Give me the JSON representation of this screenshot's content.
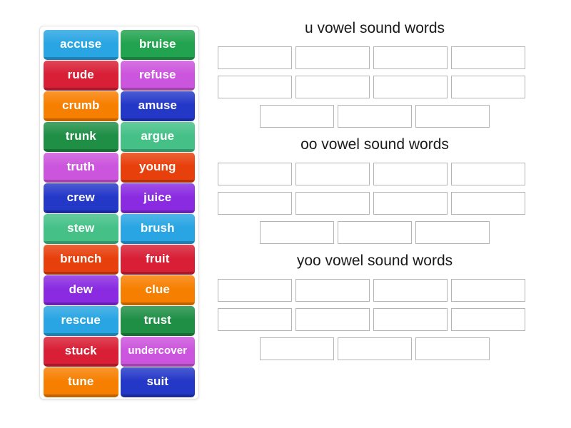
{
  "activity": {
    "type": "group-sort",
    "word_bank": {
      "tiles": [
        {
          "label": "accuse",
          "color": "#29a5e3"
        },
        {
          "label": "bruise",
          "color": "#22a34f"
        },
        {
          "label": "rude",
          "color": "#d81f35"
        },
        {
          "label": "refuse",
          "color": "#cc55dd"
        },
        {
          "label": "crumb",
          "color": "#f77f00"
        },
        {
          "label": "amuse",
          "color": "#2438c8"
        },
        {
          "label": "trunk",
          "color": "#1f8f46"
        },
        {
          "label": "argue",
          "color": "#45c188"
        },
        {
          "label": "truth",
          "color": "#cc55dd"
        },
        {
          "label": "young",
          "color": "#e8400c"
        },
        {
          "label": "crew",
          "color": "#2438c8"
        },
        {
          "label": "juice",
          "color": "#8a2be2"
        },
        {
          "label": "stew",
          "color": "#45c188"
        },
        {
          "label": "brush",
          "color": "#29a5e3"
        },
        {
          "label": "brunch",
          "color": "#e8400c"
        },
        {
          "label": "fruit",
          "color": "#d81f35"
        },
        {
          "label": "dew",
          "color": "#8a2be2"
        },
        {
          "label": "clue",
          "color": "#f77f00"
        },
        {
          "label": "rescue",
          "color": "#29a5e3"
        },
        {
          "label": "trust",
          "color": "#1f8f46"
        },
        {
          "label": "stuck",
          "color": "#d81f35"
        },
        {
          "label": "undercover",
          "color": "#cc55dd"
        },
        {
          "label": "tune",
          "color": "#f77f00"
        },
        {
          "label": "suit",
          "color": "#2438c8"
        }
      ]
    },
    "groups": [
      {
        "title": "u vowel sound words",
        "rows": [
          {
            "centered": false,
            "slots": [
              "",
              "",
              "",
              ""
            ]
          },
          {
            "centered": false,
            "slots": [
              "",
              "",
              "",
              ""
            ]
          },
          {
            "centered": true,
            "slots": [
              "",
              "",
              ""
            ]
          }
        ]
      },
      {
        "title": "oo vowel sound words",
        "rows": [
          {
            "centered": false,
            "slots": [
              "",
              "",
              "",
              ""
            ]
          },
          {
            "centered": false,
            "slots": [
              "",
              "",
              "",
              ""
            ]
          },
          {
            "centered": true,
            "slots": [
              "",
              "",
              ""
            ]
          }
        ]
      },
      {
        "title": "yoo vowel sound words",
        "rows": [
          {
            "centered": false,
            "slots": [
              "",
              "",
              "",
              ""
            ]
          },
          {
            "centered": false,
            "slots": [
              "",
              "",
              "",
              ""
            ]
          },
          {
            "centered": true,
            "slots": [
              "",
              "",
              ""
            ]
          }
        ]
      }
    ]
  }
}
